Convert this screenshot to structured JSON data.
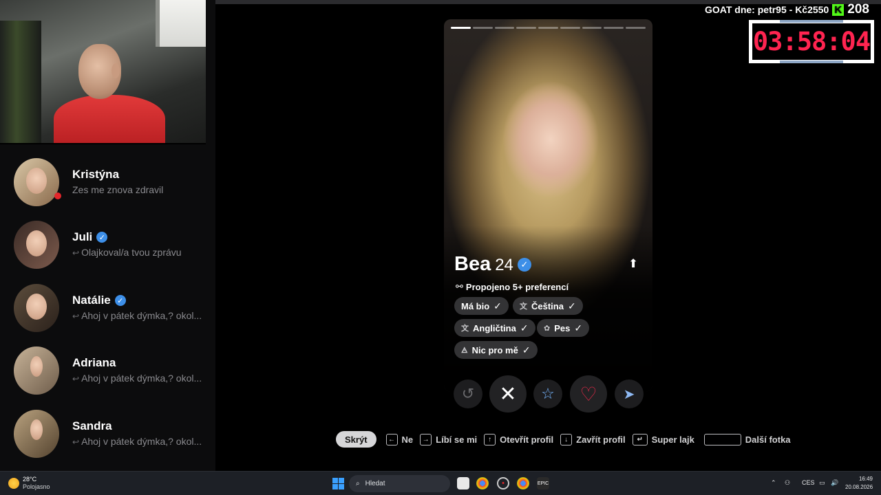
{
  "overlay": {
    "goat_text": "GOAT dne: petr95 - Kč2550",
    "kick_letter": "K",
    "viewer_count": "208",
    "timer": "03:58:04"
  },
  "matches": [
    {
      "name": "Kristýna",
      "verified": false,
      "reply": false,
      "message": "Zes me znova zdravil",
      "online": true
    },
    {
      "name": "Juli",
      "verified": true,
      "reply": true,
      "message": "Olajkoval/a tvou zprávu",
      "online": false
    },
    {
      "name": "Natálie",
      "verified": true,
      "reply": true,
      "message": "Ahoj v pátek dýmka,? okol...",
      "online": false
    },
    {
      "name": "Adriana",
      "verified": false,
      "reply": true,
      "message": "Ahoj v pátek dýmka,? okol...",
      "online": false
    },
    {
      "name": "Sandra",
      "verified": false,
      "reply": true,
      "message": "Ahoj v pátek dýmka,? okol...",
      "online": false
    }
  ],
  "profile": {
    "name": "Bea",
    "age": "24",
    "photo_count": 9,
    "active_photo": 0,
    "preferences": "Propojeno 5+ preferencí",
    "tags": [
      {
        "label": "Má bio",
        "icon": ""
      },
      {
        "label": "Čeština",
        "icon": "translate-icon"
      },
      {
        "label": "Angličtina",
        "icon": "translate-icon"
      },
      {
        "label": "Pes",
        "icon": "paw-icon"
      },
      {
        "label": "Nic pro mě",
        "icon": "glass-icon"
      }
    ]
  },
  "shortcuts": {
    "hide": "Skrýt",
    "items": [
      {
        "key": "←",
        "label": "Ne"
      },
      {
        "key": "→",
        "label": "Líbí se mi"
      },
      {
        "key": "↑",
        "label": "Otevřít profil"
      },
      {
        "key": "↓",
        "label": "Zavřít profil"
      },
      {
        "key": "↵",
        "label": "Super lajk"
      },
      {
        "key": "",
        "label": "Další fotka"
      }
    ]
  },
  "taskbar": {
    "temp": "28°C",
    "weather": "Polojasno",
    "search_placeholder": "Hledat",
    "language": "CES",
    "time": "16:49",
    "date": "20.08.2026"
  },
  "colors": {
    "like": "#e52a48",
    "super_like": "#77b6ff",
    "verified": "#3d8fe8",
    "timer": "#ff2450",
    "kick": "#53fc18"
  }
}
